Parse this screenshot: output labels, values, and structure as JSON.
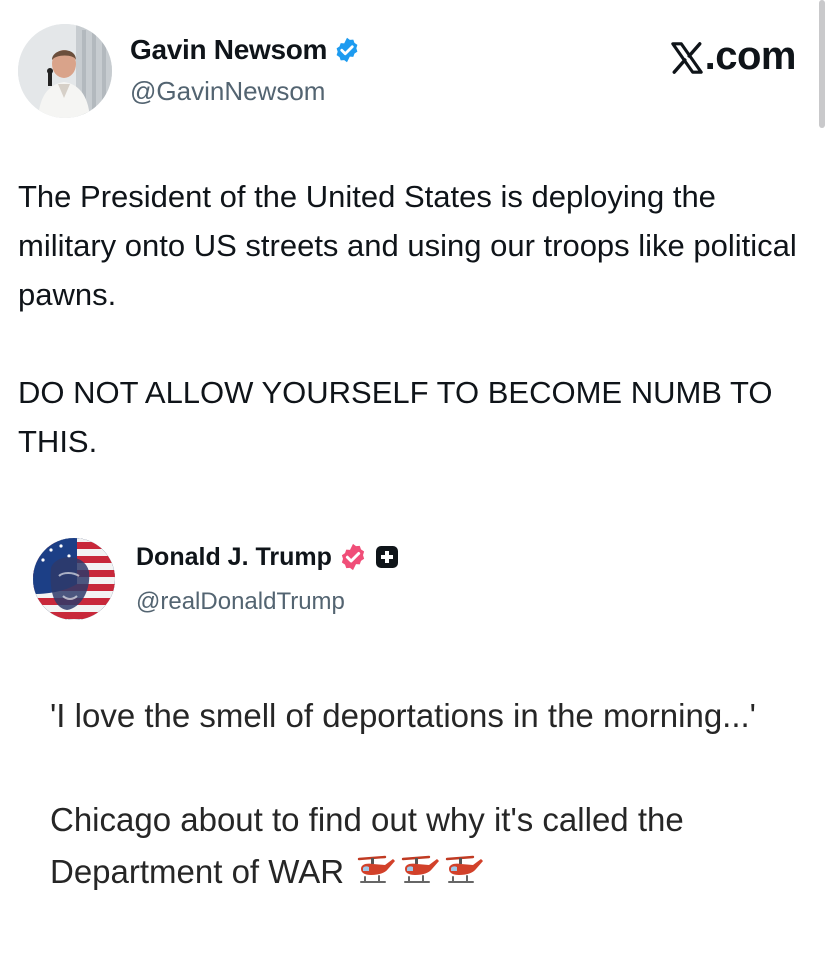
{
  "post": {
    "author": {
      "name": "Gavin Newsom",
      "handle": "@GavinNewsom",
      "avatar_icon": "person-avatar",
      "verified_icon": "verified-badge-icon",
      "verified_color": "#1d9bf0"
    },
    "brand": {
      "icon": "x-logo-icon",
      "suffix": ".com"
    },
    "text": {
      "paragraph_1": "The President of the United States is deploying the military onto US streets and using our troops like political pawns.",
      "paragraph_2": "DO NOT ALLOW YOURSELF TO BECOME NUMB TO THIS."
    }
  },
  "quoted_post": {
    "author": {
      "name": "Donald J. Trump",
      "handle": "@realDonaldTrump",
      "avatar_icon": "flag-portrait-avatar",
      "verified_icon": "verified-badge-icon",
      "verified_color": "#f04e78",
      "extra_icon": "plus-square-icon"
    },
    "text": {
      "paragraph_1": "'I love the smell of deportations in the morning...'",
      "paragraph_2": "Chicago about to find out why it's called the Department of WAR",
      "emoji": [
        "helicopter-icon",
        "helicopter-icon",
        "helicopter-icon"
      ]
    }
  },
  "colors": {
    "text": "#0f1419",
    "secondary_text": "#536471",
    "background": "#ffffff"
  }
}
